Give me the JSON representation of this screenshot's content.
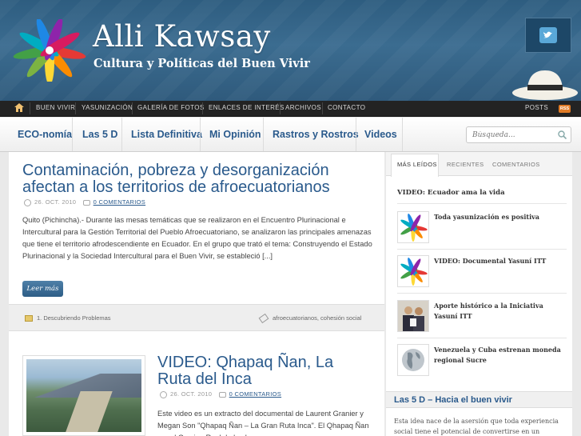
{
  "header": {
    "title": "Alli Kawsay",
    "tagline": "Cultura y Políticas del Buen Vivir",
    "icons": [
      "flower-logo-icon",
      "twitter-icon",
      "panama-hat-icon"
    ]
  },
  "topnav": {
    "items": [
      "BUEN VIVIR",
      "YASUNIZACIÓN",
      "GALERÍA DE FOTOS",
      "ENLACES DE INTERÉS",
      "ARCHIVOS",
      "CONTACTO"
    ],
    "posts": "POSTS",
    "rss": "RSS"
  },
  "catnav": {
    "items": [
      "ECO-nomía",
      "Las 5 D",
      "Lista Definitiva",
      "Mi Opinión",
      "Rastros y Rostros",
      "Videos"
    ],
    "search_placeholder": "Búsqueda..."
  },
  "posts": [
    {
      "title": "Contaminación, pobreza y desorganización afectan a los territorios de afroecuatorianos",
      "date": "26. OCT. 2010",
      "comments": "0 COMENTARIOS",
      "excerpt": "Quito (Pichincha).- Durante las mesas temáticas que se realizaron en el Encuentro Plurinacional e Intercultural para la Gestión Territorial del Pueblo Afroecuatoriano, se analizaron las principales amenazas que tiene el territorio afrodescendiente en Ecuador. En el grupo que trató el tema: Construyendo el Estado Plurinacional y la Sociedad Intercultural para el Buen Vivir, se estableció [...]",
      "read_more": "Leer más",
      "category": "1. Descubriendo Problemas",
      "tags": "afroecuatorianos, cohesión social"
    },
    {
      "title": "VIDEO: Qhapaq Ñan, La Ruta del Inca",
      "date": "26. OCT. 2010",
      "comments": "0 COMENTARIOS",
      "excerpt": "Este video es un extracto del documental de Laurent Granier y Megan Son \"Qhapaq Ñan – La Gran Ruta Inca\". El Qhapaq Ñan era el Camino Real de los Incas"
    }
  ],
  "sidebar": {
    "tabs": [
      "MÁS LEÍDOS",
      "RECIENTES",
      "COMENTARIOS"
    ],
    "top_link": "VIDEO: Ecuador ama la vida",
    "items": [
      {
        "text": "Toda yasunización es positiva",
        "icon": "flower-logo-icon"
      },
      {
        "text": "VIDEO: Documental Yasuní ITT",
        "icon": "flower-logo-icon"
      },
      {
        "text": "Aporte histórico a la Iniciativa Yasuní ITT",
        "icon": "people-photo-icon"
      },
      {
        "text": "Venezuela y Cuba estrenan moneda regional Sucre",
        "icon": "globe-icon"
      }
    ],
    "widget_title": "Las 5 D – Hacia el buen vivir",
    "widget_text": "Esta idea nace de la asersión que toda experiencia social tiene el potencial de convertirse en un peldaño hacia el buen vivir."
  },
  "colors": {
    "header_blue": "#2e5d80",
    "link_blue": "#2a5a8c",
    "topnav_bg": "#232323",
    "rss_orange": "#e07b26"
  }
}
